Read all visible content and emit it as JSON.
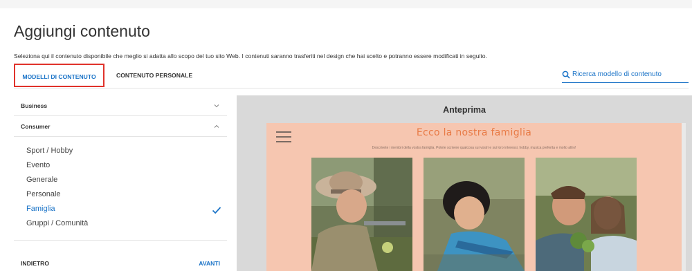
{
  "header": {
    "title": "Aggiungi contenuto",
    "description": "Seleziona qui il contenuto disponibile che meglio si adatta allo scopo del tuo sito Web. I contenuti saranno trasferiti nel design che hai scelto e potranno essere modificati in seguito."
  },
  "tabs": [
    {
      "label": "MODELLI DI CONTENUTO",
      "active": true
    },
    {
      "label": "CONTENUTO PERSONALE",
      "active": false
    }
  ],
  "search": {
    "label": "Ricerca modello di contenuto",
    "icon": "search-icon"
  },
  "sidebar": {
    "categories": [
      {
        "label": "Business",
        "expanded": false,
        "icon": "chevron-down-icon"
      },
      {
        "label": "Consumer",
        "expanded": true,
        "icon": "chevron-up-icon"
      }
    ],
    "items": [
      {
        "label": "Sport / Hobby",
        "selected": false
      },
      {
        "label": "Evento",
        "selected": false
      },
      {
        "label": "Generale",
        "selected": false
      },
      {
        "label": "Personale",
        "selected": false
      },
      {
        "label": "Famiglia",
        "selected": true
      },
      {
        "label": "Gruppi / Comunità",
        "selected": false
      }
    ],
    "back_label": "INDIETRO",
    "next_label": "AVANTI"
  },
  "preview": {
    "title": "Anteprima",
    "page_title": "Ecco la nostra famiglia",
    "page_desc": "Descrivete i membri della vostra famiglia. Potete scrivere qualcosa sui vostri e sui loro interessi, hobby, musica preferita e molto altro!",
    "photos": [
      "woman-straw-hat-photo",
      "child-lying-photo",
      "father-daughter-plants-photo"
    ]
  },
  "colors": {
    "accent": "#1a73c7",
    "highlight_border": "#e0322b",
    "preview_bg": "#f6c6b0",
    "preview_title": "#e87a45"
  }
}
